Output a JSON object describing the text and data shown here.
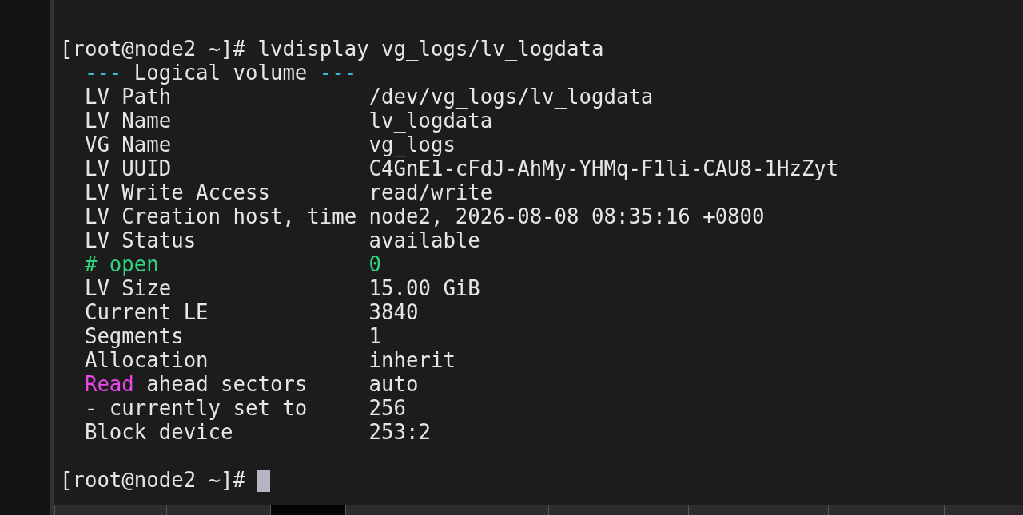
{
  "terminal": {
    "lines": [
      {
        "kind": "prompt",
        "prompt": "[root@node2 ~]#",
        "command": "lvdisplay vg_logs/lv_logdata"
      },
      {
        "kind": "header",
        "segments": [
          {
            "text": "---",
            "color": "#3fb6e6"
          },
          {
            "text": "Logical volume"
          },
          {
            "text": "---",
            "color": "#3fb6e6"
          }
        ]
      },
      {
        "kind": "field",
        "label": [
          {
            "text": "LV Path"
          }
        ],
        "value": {
          "text": "/dev/vg_logs/lv_logdata"
        }
      },
      {
        "kind": "field",
        "label": [
          {
            "text": "LV Name"
          }
        ],
        "value": {
          "text": "lv_logdata"
        }
      },
      {
        "kind": "field",
        "label": [
          {
            "text": "VG Name"
          }
        ],
        "value": {
          "text": "vg_logs"
        }
      },
      {
        "kind": "field",
        "label": [
          {
            "text": "LV UUID"
          }
        ],
        "value": {
          "text": "C4GnE1-cFdJ-AhMy-YHMq-F1li-CAU8-1HzZyt"
        }
      },
      {
        "kind": "field",
        "label": [
          {
            "text": "LV Write Access"
          }
        ],
        "value": {
          "text": "read/write"
        }
      },
      {
        "kind": "field",
        "label": [
          {
            "text": "LV Creation host, time"
          }
        ],
        "value": {
          "text": "node2, 2026-08-08 08:35:16 +0800"
        }
      },
      {
        "kind": "field",
        "label": [
          {
            "text": "LV Status"
          }
        ],
        "value": {
          "text": "available"
        }
      },
      {
        "kind": "field",
        "label": [
          {
            "text": "# open",
            "color": "#2ed47e"
          }
        ],
        "value": {
          "text": "0",
          "color": "#2ed47e"
        }
      },
      {
        "kind": "field",
        "label": [
          {
            "text": "LV Size"
          }
        ],
        "value": {
          "text": "15.00 GiB"
        }
      },
      {
        "kind": "field",
        "label": [
          {
            "text": "Current LE"
          }
        ],
        "value": {
          "text": "3840"
        }
      },
      {
        "kind": "field",
        "label": [
          {
            "text": "Segments"
          }
        ],
        "value": {
          "text": "1"
        }
      },
      {
        "kind": "field",
        "label": [
          {
            "text": "Allocation"
          }
        ],
        "value": {
          "text": "inherit"
        }
      },
      {
        "kind": "field",
        "label": [
          {
            "text": "Read",
            "color": "#e848e8"
          },
          {
            "text": "ahead sectors"
          }
        ],
        "value": {
          "text": "auto"
        }
      },
      {
        "kind": "field",
        "label": [
          {
            "text": "- currently set to"
          }
        ],
        "value": {
          "text": "256"
        }
      },
      {
        "kind": "field",
        "label": [
          {
            "text": "Block device"
          }
        ],
        "value": {
          "text": "253:2"
        }
      },
      {
        "kind": "blank"
      },
      {
        "kind": "prompt",
        "prompt": "[root@node2 ~]#",
        "cursor": true
      }
    ]
  },
  "taskbar": {
    "buttons": [
      {
        "selected": false
      },
      {
        "selected": false
      },
      {
        "selected": true
      },
      {
        "selected": false
      },
      {
        "selected": false
      },
      {
        "selected": false
      },
      {
        "selected": false
      },
      {
        "selected": false
      }
    ]
  }
}
